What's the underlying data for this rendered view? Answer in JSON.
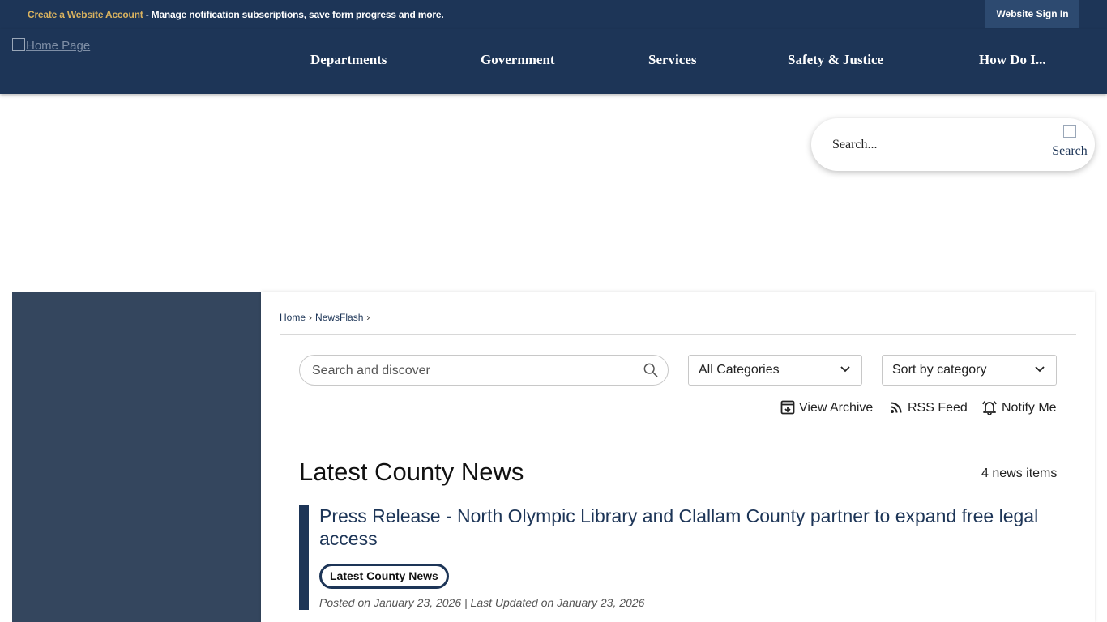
{
  "topbar": {
    "account_link": "Create a Website Account",
    "account_text": " - Manage notification subscriptions, save form progress and more.",
    "signin_label": "Website Sign In"
  },
  "header": {
    "logo_alt": "Home Page",
    "nav": [
      "Departments",
      "Government",
      "Services",
      "Safety & Justice",
      "How Do I..."
    ]
  },
  "site_search": {
    "placeholder": "Search...",
    "button_alt": "Search"
  },
  "breadcrumb": [
    "Home",
    "NewsFlash"
  ],
  "filters": {
    "search_placeholder": "Search and discover",
    "category_value": "All Categories",
    "sort_value": "Sort by category"
  },
  "actions": {
    "archive": "View Archive",
    "rss": "RSS Feed",
    "notify": "Notify Me"
  },
  "section": {
    "title": "Latest County News",
    "count": "4 news items"
  },
  "news": [
    {
      "title": "Press Release - North Olympic Library and Clallam County partner to expand free legal access",
      "tag": "Latest County News",
      "meta": "Posted on January 23, 2026 | Last Updated on January 23, 2026"
    }
  ]
}
